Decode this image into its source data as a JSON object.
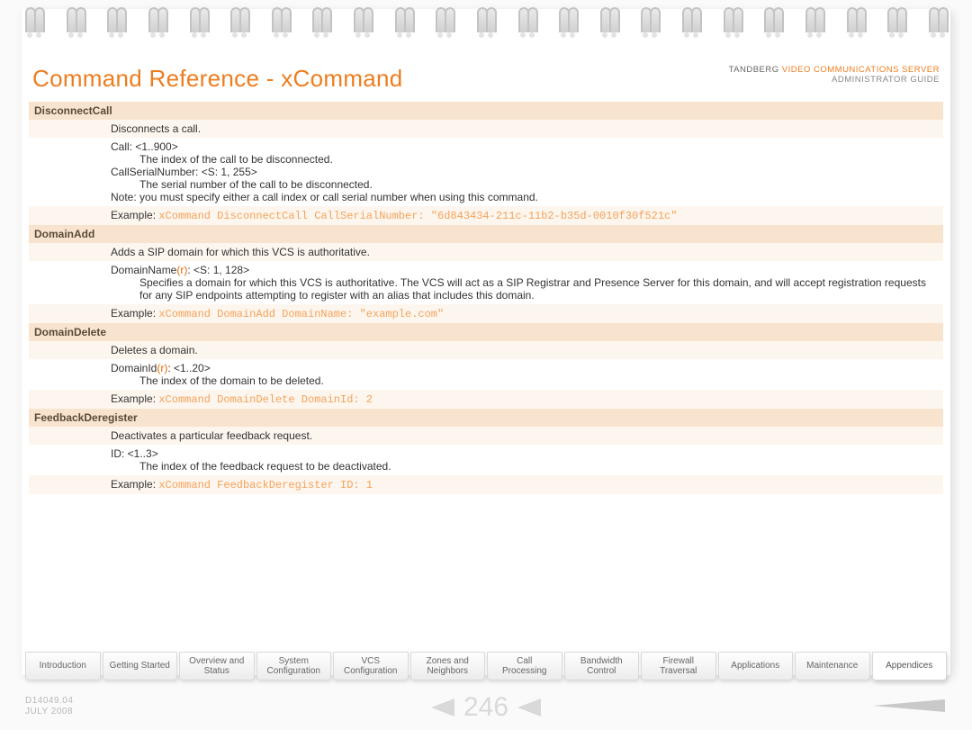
{
  "header": {
    "title": "Command Reference - xCommand",
    "brandLeft": "TANDBERG",
    "brandHighlight": "VIDEO COMMUNICATIONS SERVER",
    "brandSub": "ADMINISTRATOR GUIDE"
  },
  "commands": [
    {
      "name": "DisconnectCall",
      "desc": "Disconnects a call.",
      "params": [
        {
          "label": "Call: <1..900>",
          "req": false,
          "desc": "The index of the call to be disconnected."
        },
        {
          "label": "CallSerialNumber: <S: 1, 255>",
          "req": false,
          "desc": "The serial number of the call to be disconnected."
        }
      ],
      "note": "Note: you must specify either a call index or call serial number when using this command.",
      "exampleLabel": "Example:",
      "exampleCode": "xCommand DisconnectCall CallSerialNumber: \"6d843434-211c-11b2-b35d-0010f30f521c\""
    },
    {
      "name": "DomainAdd",
      "desc": "Adds a SIP domain for which this VCS is authoritative.",
      "params": [
        {
          "label": "DomainName",
          "req": true,
          "suffix": ": <S: 1, 128>",
          "desc": "Specifies a domain for which this VCS is authoritative. The VCS will act as a SIP Registrar and Presence Server for this domain, and will accept registration requests for any SIP endpoints attempting to register with an alias that includes this domain."
        }
      ],
      "exampleLabel": "Example:",
      "exampleCode": "xCommand DomainAdd DomainName: \"example.com\""
    },
    {
      "name": "DomainDelete",
      "desc": "Deletes a domain.",
      "params": [
        {
          "label": "DomainId",
          "req": true,
          "suffix": ": <1..20>",
          "desc": "The index of the domain to be deleted."
        }
      ],
      "exampleLabel": "Example:",
      "exampleCode": "xCommand DomainDelete DomainId: 2"
    },
    {
      "name": "FeedbackDeregister",
      "desc": "Deactivates a particular feedback request.",
      "params": [
        {
          "label": "ID: <1..3>",
          "req": false,
          "desc": "The index of the feedback request to be deactivated."
        }
      ],
      "exampleLabel": "Example:",
      "exampleCode": "xCommand FeedbackDeregister ID: 1"
    }
  ],
  "tabs": [
    {
      "l1": "Introduction",
      "l2": ""
    },
    {
      "l1": "Getting Started",
      "l2": ""
    },
    {
      "l1": "Overview and",
      "l2": "Status"
    },
    {
      "l1": "System",
      "l2": "Configuration"
    },
    {
      "l1": "VCS",
      "l2": "Configuration"
    },
    {
      "l1": "Zones and",
      "l2": "Neighbors"
    },
    {
      "l1": "Call",
      "l2": "Processing"
    },
    {
      "l1": "Bandwidth",
      "l2": "Control"
    },
    {
      "l1": "Firewall",
      "l2": "Traversal"
    },
    {
      "l1": "Applications",
      "l2": ""
    },
    {
      "l1": "Maintenance",
      "l2": ""
    },
    {
      "l1": "Appendices",
      "l2": ""
    }
  ],
  "activeTabIndex": 11,
  "meta": {
    "doc": "D14049.04",
    "date": "JULY 2008"
  },
  "page": "246"
}
